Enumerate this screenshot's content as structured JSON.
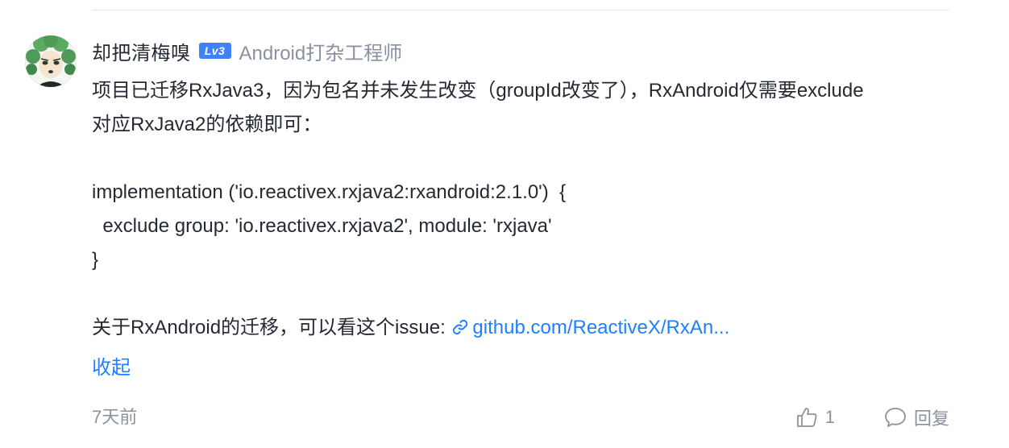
{
  "comment": {
    "username": "却把清梅嗅",
    "level": "Lv3",
    "user_title": "Android打杂工程师",
    "body_lines": [
      "项目已迁移RxJava3，因为包名并未发生改变（groupId改变了），RxAndroid仅需要exclude",
      "对应RxJava2的依赖即可：",
      "",
      "implementation ('io.reactivex.rxjava2:rxandroid:2.1.0')  {",
      "  exclude group: 'io.reactivex.rxjava2', module: 'rxjava'",
      "}",
      ""
    ],
    "issue_prefix": "关于RxAndroid的迁移，可以看这个issue: ",
    "issue_link_text": "github.com/ReactiveX/RxAn...",
    "collapse_label": "收起",
    "time": "7天前",
    "like_count": "1",
    "reply_label": "回复"
  },
  "colors": {
    "accent": "#1e80ff",
    "muted": "#8a919f",
    "badge": "#3d83f5",
    "text": "#252933"
  },
  "icons": {
    "like": "thumbs-up-icon",
    "reply": "comment-bubble-icon",
    "link": "link-icon"
  }
}
